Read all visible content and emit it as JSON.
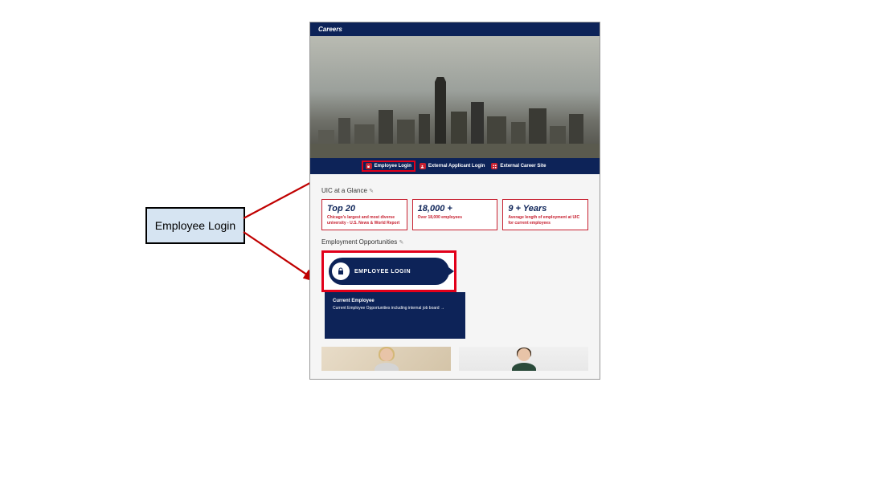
{
  "annotation": {
    "callout_label": "Employee Login"
  },
  "topbar": {
    "title": "Careers"
  },
  "nav": {
    "items": [
      {
        "label": "Employee Login",
        "highlighted": true
      },
      {
        "label": "External Applicant Login",
        "highlighted": false
      },
      {
        "label": "External Career Site",
        "highlighted": false
      }
    ]
  },
  "glance": {
    "heading": "UIC at a Glance",
    "stats": [
      {
        "headline": "Top 20",
        "desc": "Chicago's largest and most diverse university - U.S. News & World Report"
      },
      {
        "headline": "18,000 +",
        "desc": "Over 18,000 employees"
      },
      {
        "headline": "9 + Years",
        "desc": "Average length of employment at UIC for current employees"
      }
    ]
  },
  "opportunities": {
    "heading": "Employment Opportunities",
    "login_button": "EMPLOYEE LOGIN",
    "current_employee": {
      "title": "Current Employee",
      "desc": "Current Employee Opportunities including internal job board →"
    }
  }
}
